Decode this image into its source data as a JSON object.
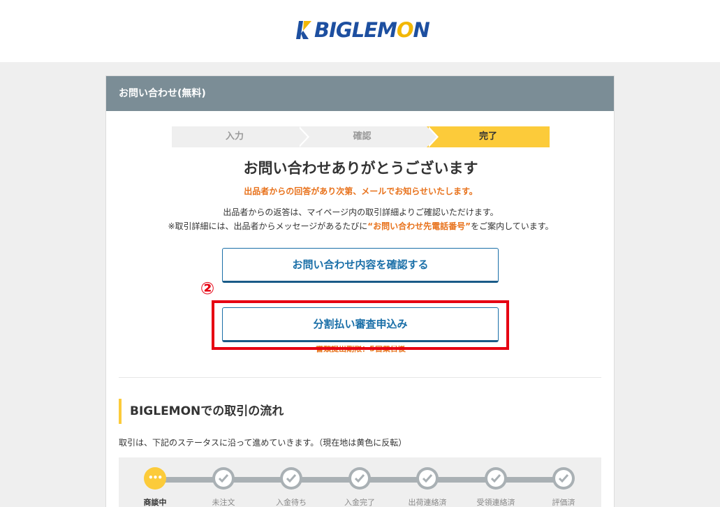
{
  "header": {
    "logo_text_pre": "BIGLEM",
    "logo_text_o": "O",
    "logo_text_post": "N"
  },
  "card": {
    "title": "お問い合わせ(無料)"
  },
  "steps": [
    {
      "label": "入力",
      "active": false
    },
    {
      "label": "確認",
      "active": false
    },
    {
      "label": "完了",
      "active": true
    }
  ],
  "result": {
    "heading": "お問い合わせありがとうございます",
    "notice": "出品者からの回答があり次第、メールでお知らせいたします。",
    "info_line1": "出品者からの返答は、マイページ内の取引詳細よりご確認いただけます。",
    "info_line2_pre": "※取引詳細には、出品者からメッセージがあるたびに",
    "info_line2_hl": "“お問い合わせ先電話番号”",
    "info_line2_post": "をご案内しています。"
  },
  "buttons": {
    "confirm_label": "お問い合わせ内容を確認する",
    "installment_label": "分割払い審査申込み",
    "installment_note": "書類提出期限：5営業日後"
  },
  "annotation": {
    "marker": "②"
  },
  "flow": {
    "title": "BIGLEMONでの取引の流れ",
    "description": "取引は、下記のステータスに沿って進めていきます。（現在地は黄色に反転）",
    "steps": [
      {
        "label": "商談中",
        "active": true
      },
      {
        "label": "未注文",
        "active": false
      },
      {
        "label": "入金待ち",
        "active": false
      },
      {
        "label": "入金完了",
        "active": false
      },
      {
        "label": "出荷連絡済",
        "active": false
      },
      {
        "label": "受領連絡済",
        "active": false
      },
      {
        "label": "評価済",
        "active": false
      }
    ]
  },
  "colors": {
    "accent_yellow": "#fccb3a",
    "header_gray": "#7b8d96",
    "button_blue": "#1a6fa8",
    "warning_orange": "#e8721c",
    "highlight_red": "#e60012"
  }
}
